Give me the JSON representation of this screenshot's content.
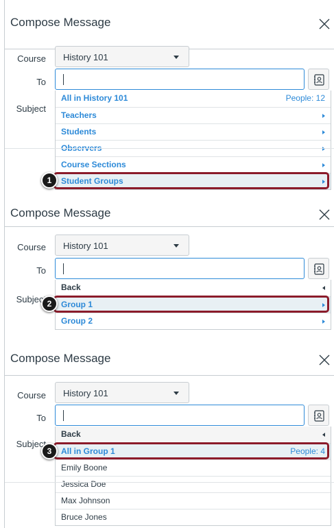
{
  "title": "Compose Message",
  "close_icon": "close-icon",
  "labels": {
    "course": "Course",
    "to": "To",
    "subject": "Subject"
  },
  "course_select": {
    "value": "History 101"
  },
  "accent_color": "#2d8ad8",
  "highlight_color": "#8b1b2a",
  "steps": [
    {
      "badge": "1",
      "rows": [
        {
          "label": "All in History 101",
          "right": "People: 12"
        },
        {
          "label": "Teachers"
        },
        {
          "label": "Students"
        },
        {
          "label": "Observers"
        },
        {
          "label": "Course Sections"
        },
        {
          "label": "Student Groups"
        }
      ]
    },
    {
      "badge": "2",
      "rows": [
        {
          "label": "Back"
        },
        {
          "label": "Group 1"
        },
        {
          "label": "Group 2"
        }
      ]
    },
    {
      "badge": "3",
      "rows": [
        {
          "label": "Back"
        },
        {
          "label": "All in Group 1",
          "right": "People: 4"
        },
        {
          "label": "Emily Boone"
        },
        {
          "label": "Jessica Doe"
        },
        {
          "label": "Max Johnson"
        },
        {
          "label": "Bruce Jones"
        }
      ]
    }
  ]
}
